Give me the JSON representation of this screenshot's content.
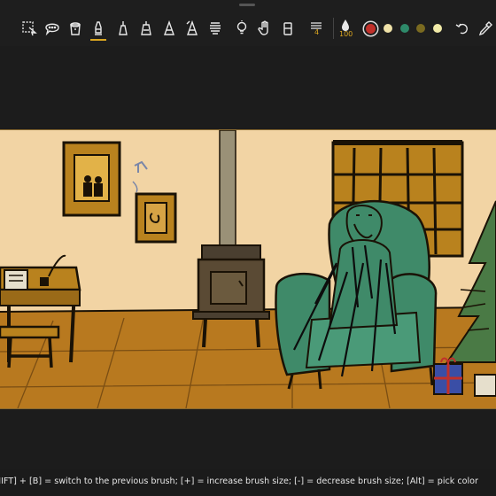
{
  "toolbar": {
    "tools": [
      {
        "name": "select-tool",
        "icon": "lasso-select-icon"
      },
      {
        "name": "comment-tool",
        "icon": "speech-bubble-icon"
      },
      {
        "name": "paint-bucket-tool",
        "icon": "bucket-icon"
      },
      {
        "name": "marker-tool",
        "icon": "marker-icon",
        "active": true
      },
      {
        "name": "pen-tool",
        "icon": "pen-nib-icon"
      },
      {
        "name": "ink-pen-tool",
        "icon": "ink-pen-icon"
      },
      {
        "name": "pencil-tool",
        "icon": "pencil-icon"
      },
      {
        "name": "calligraphy-tool",
        "icon": "calligraphy-icon"
      },
      {
        "name": "smudge-tool",
        "icon": "smudge-icon"
      },
      {
        "name": "idea-tool",
        "icon": "lightbulb-icon"
      },
      {
        "name": "hand-tool",
        "icon": "hand-icon"
      },
      {
        "name": "eraser-tool",
        "icon": "eraser-icon"
      }
    ],
    "layer_count": "4",
    "brush_size": "100",
    "colors": {
      "current": "#c0302a",
      "swatches": [
        "#f0e2a8",
        "#2e8a6a",
        "#7a6a20",
        "#f2eba8"
      ]
    },
    "undo_icon": "undo-icon",
    "eyedropper_icon": "eyedropper-icon"
  },
  "hint": "tch to next brush; [SHIFT] + [B] = switch to the previous brush; [+] = increase brush size; [-] = decrease brush size; [Alt] = pick color"
}
